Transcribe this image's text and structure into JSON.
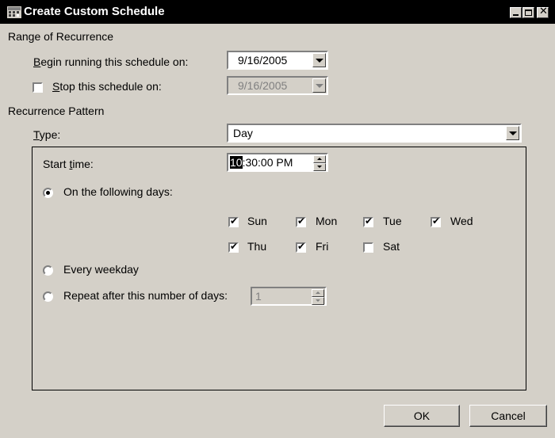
{
  "window": {
    "title": "Create Custom Schedule",
    "icon": "schedule-window-icon"
  },
  "range": {
    "heading": "Range of Recurrence",
    "begin_label_ul": "B",
    "begin_label_rest": "egin running this schedule on:",
    "begin_value": "9/16/2005",
    "stop_checked": false,
    "stop_label_ul": "S",
    "stop_label_rest": "top this schedule on:",
    "stop_value": "9/16/2005"
  },
  "pattern": {
    "heading": "Recurrence Pattern",
    "type_label_ul": "T",
    "type_label_rest": "ype:",
    "type_value": "Day",
    "start_time_label_pre": "Start ",
    "start_time_label_ul": "t",
    "start_time_label_rest": "ime:",
    "start_time_hour": "10",
    "start_time_rest": ":30:00 PM",
    "options": {
      "following_days": "On the following days:",
      "every_weekday": "Every weekday",
      "repeat_after": "Repeat after this number of days:"
    },
    "selected_option": "following_days",
    "repeat_value": "1",
    "days": [
      {
        "label": "Sun",
        "checked": true
      },
      {
        "label": "Mon",
        "checked": true
      },
      {
        "label": "Tue",
        "checked": true
      },
      {
        "label": "Wed",
        "checked": true
      },
      {
        "label": "Thu",
        "checked": true
      },
      {
        "label": "Fri",
        "checked": true
      },
      {
        "label": "Sat",
        "checked": false
      }
    ]
  },
  "buttons": {
    "ok": "OK",
    "cancel": "Cancel"
  }
}
